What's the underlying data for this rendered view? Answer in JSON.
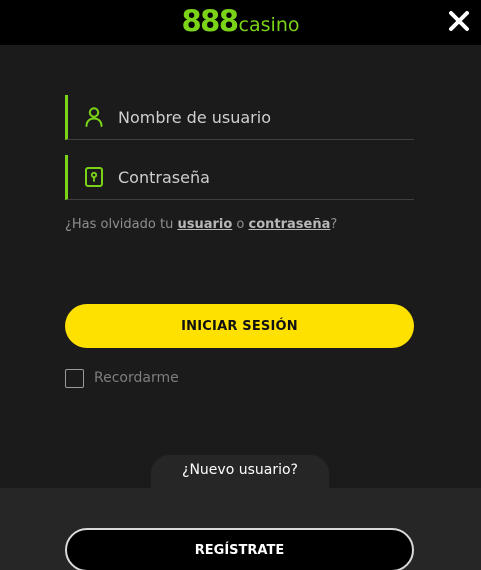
{
  "header": {
    "logo_number": "888",
    "logo_word": "casino",
    "close_icon": "close-icon"
  },
  "colors": {
    "brand_green": "#7bd318",
    "login_yellow": "#ffe100",
    "background": "#1b1b1b",
    "header_background": "#000000"
  },
  "login": {
    "username_placeholder": "Nombre de usuario",
    "username_value": "",
    "username_icon": "user-icon",
    "password_placeholder": "Contraseña",
    "password_value": "",
    "password_icon": "lock-icon",
    "forgot_prefix": "¿Has olvidado tu ",
    "forgot_username_link": "usuario",
    "forgot_or": " o ",
    "forgot_password_link": "contraseña",
    "forgot_suffix": "?",
    "submit_label": "INICIAR SESIÓN",
    "remember_label": "Recordarme",
    "remember_checked": false
  },
  "register": {
    "new_user_label": "¿Nuevo usuario?",
    "register_label": "REGÍSTRATE"
  }
}
